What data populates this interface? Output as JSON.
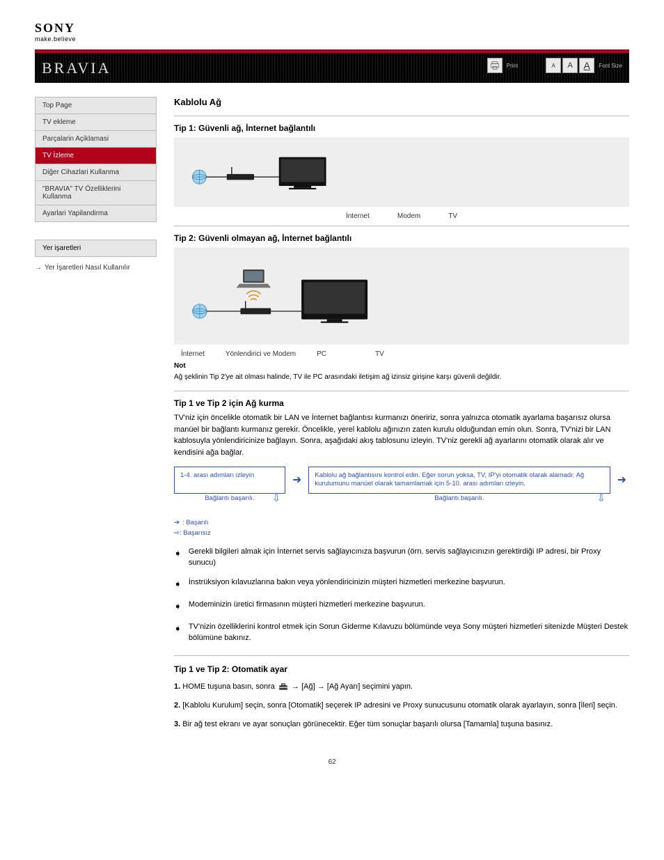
{
  "logo": {
    "brand": "SONY",
    "tagline": "make.believe"
  },
  "banner": {
    "brand": "BRAVIA",
    "print_label": "Print",
    "fontsize_label": "Font Size"
  },
  "nav": {
    "items": [
      "Top Page",
      "TV ekleme",
      "Parçalarin Açiklamasi",
      "TV İzleme",
      "Diğer Cihazlari Kullanma",
      "\"BRAVIA\" TV Özelliklerini Kullanma",
      "Ayarlari Yapilandirma"
    ],
    "active_index": 3
  },
  "bookmarks": "Yer işaretleri",
  "howto": {
    "arrow": "→",
    "text": "Yer İşaretleri Nasıl Kullanılır"
  },
  "heading": "Kablolu Ağ",
  "sect1": {
    "title": "Tip 1: Güvenli ağ, İnternet bağlantılı",
    "captions": [
      "İnternet",
      "Modem",
      "TV"
    ]
  },
  "sect2": {
    "title": "Tip 2: Güvenli olmayan ağ, İnternet bağlantılı",
    "captions": [
      "İnternet",
      "Yönlendirici ve Modem",
      "PC",
      "TV"
    ],
    "note_label": "Not",
    "note_body": "Ağ şeklinin Tip 2'ye ait olması halinde, TV ile PC arasındaki iletişim ağ izinsiz girişine karşı güvenli değildir."
  },
  "sect3": {
    "title": "Tip 1 ve Tip 2 için Ağ kurma",
    "intro": "TV'niz için öncelikle otomatik bir LAN ve İnternet bağlantısı kurmanızı öneririz, sonra yalnızca otomatik ayarlama başarısız olursa manüel bir bağlantı kurmanız gerekir. Öncelikle, yerel kablolu ağınızın zaten kurulu olduğundan emin olun. Sonra, TV'nizi bir LAN kablosuyla yönlendiricinize bağlayın. Sonra, aşağıdaki akış tablosunu izleyin. TV'niz gerekli ağ ayarlarını otomatik olarak alır ve kendisini ağa bağlar.",
    "flow": {
      "box1_line1": "1-4. arası adımları izleyin",
      "box1_sub": "Bağlantı başarılı.",
      "box2": "Kablolu ağ bağlantısını kontrol edin. Eğer sorun yoksa, TV, IP'yi otomatik olarak alamadı: Ağ kurulumunu manüel olarak tamamlamak için 5-10. arası adımları izleyin.",
      "box2_sub": "Bağlantı başarılı."
    },
    "legend": {
      "blue": ": Başarılı",
      "hollow": ": Başarısız"
    },
    "follow_items": [
      "Gerekli bilgileri almak için İnternet servis sağlayıcınıza başvurun (örn. servis sağlayıcınızın gerektirdiği IP adresi, bir Proxy sunucu)",
      "İnstrüksiyon kılavuzlarına bakın veya yönlendiricinizin müşteri hizmetleri merkezine başvurun.",
      "Modeminizin üretici firmasının müşteri hizmetleri merkezine başvurun.",
      "TV'nizin özelliklerini kontrol etmek için Sorun Giderme Kılavuzu bölümünde veya Sony müşteri hizmetleri sitenizde Müşteri Destek bölümüne bakınız."
    ]
  },
  "type3": {
    "title": "Tip 1 ve Tip 2: Otomatik ayar",
    "steps": [
      {
        "n": "1.",
        "body_a": "HOME tuşuna basın, sonra ",
        "icon": true,
        "body_b": " → [Ağ] → [Ağ Ayarı] seçimini yapın."
      },
      {
        "n": "2.",
        "body_a": "[Kablolu Kurulum] seçin, sonra [Otomatik] seçerek IP adresini ve Proxy sunucusunu otomatik olarak ayarlayın, sonra [İleri] seçin."
      },
      {
        "n": "3.",
        "body_a": "Bir ağ test ekranı ve ayar sonuçları görünecektir. Eğer tüm sonuçlar başarılı olursa [Tamamla] tuşuna basınız."
      }
    ]
  },
  "page_number": "62"
}
